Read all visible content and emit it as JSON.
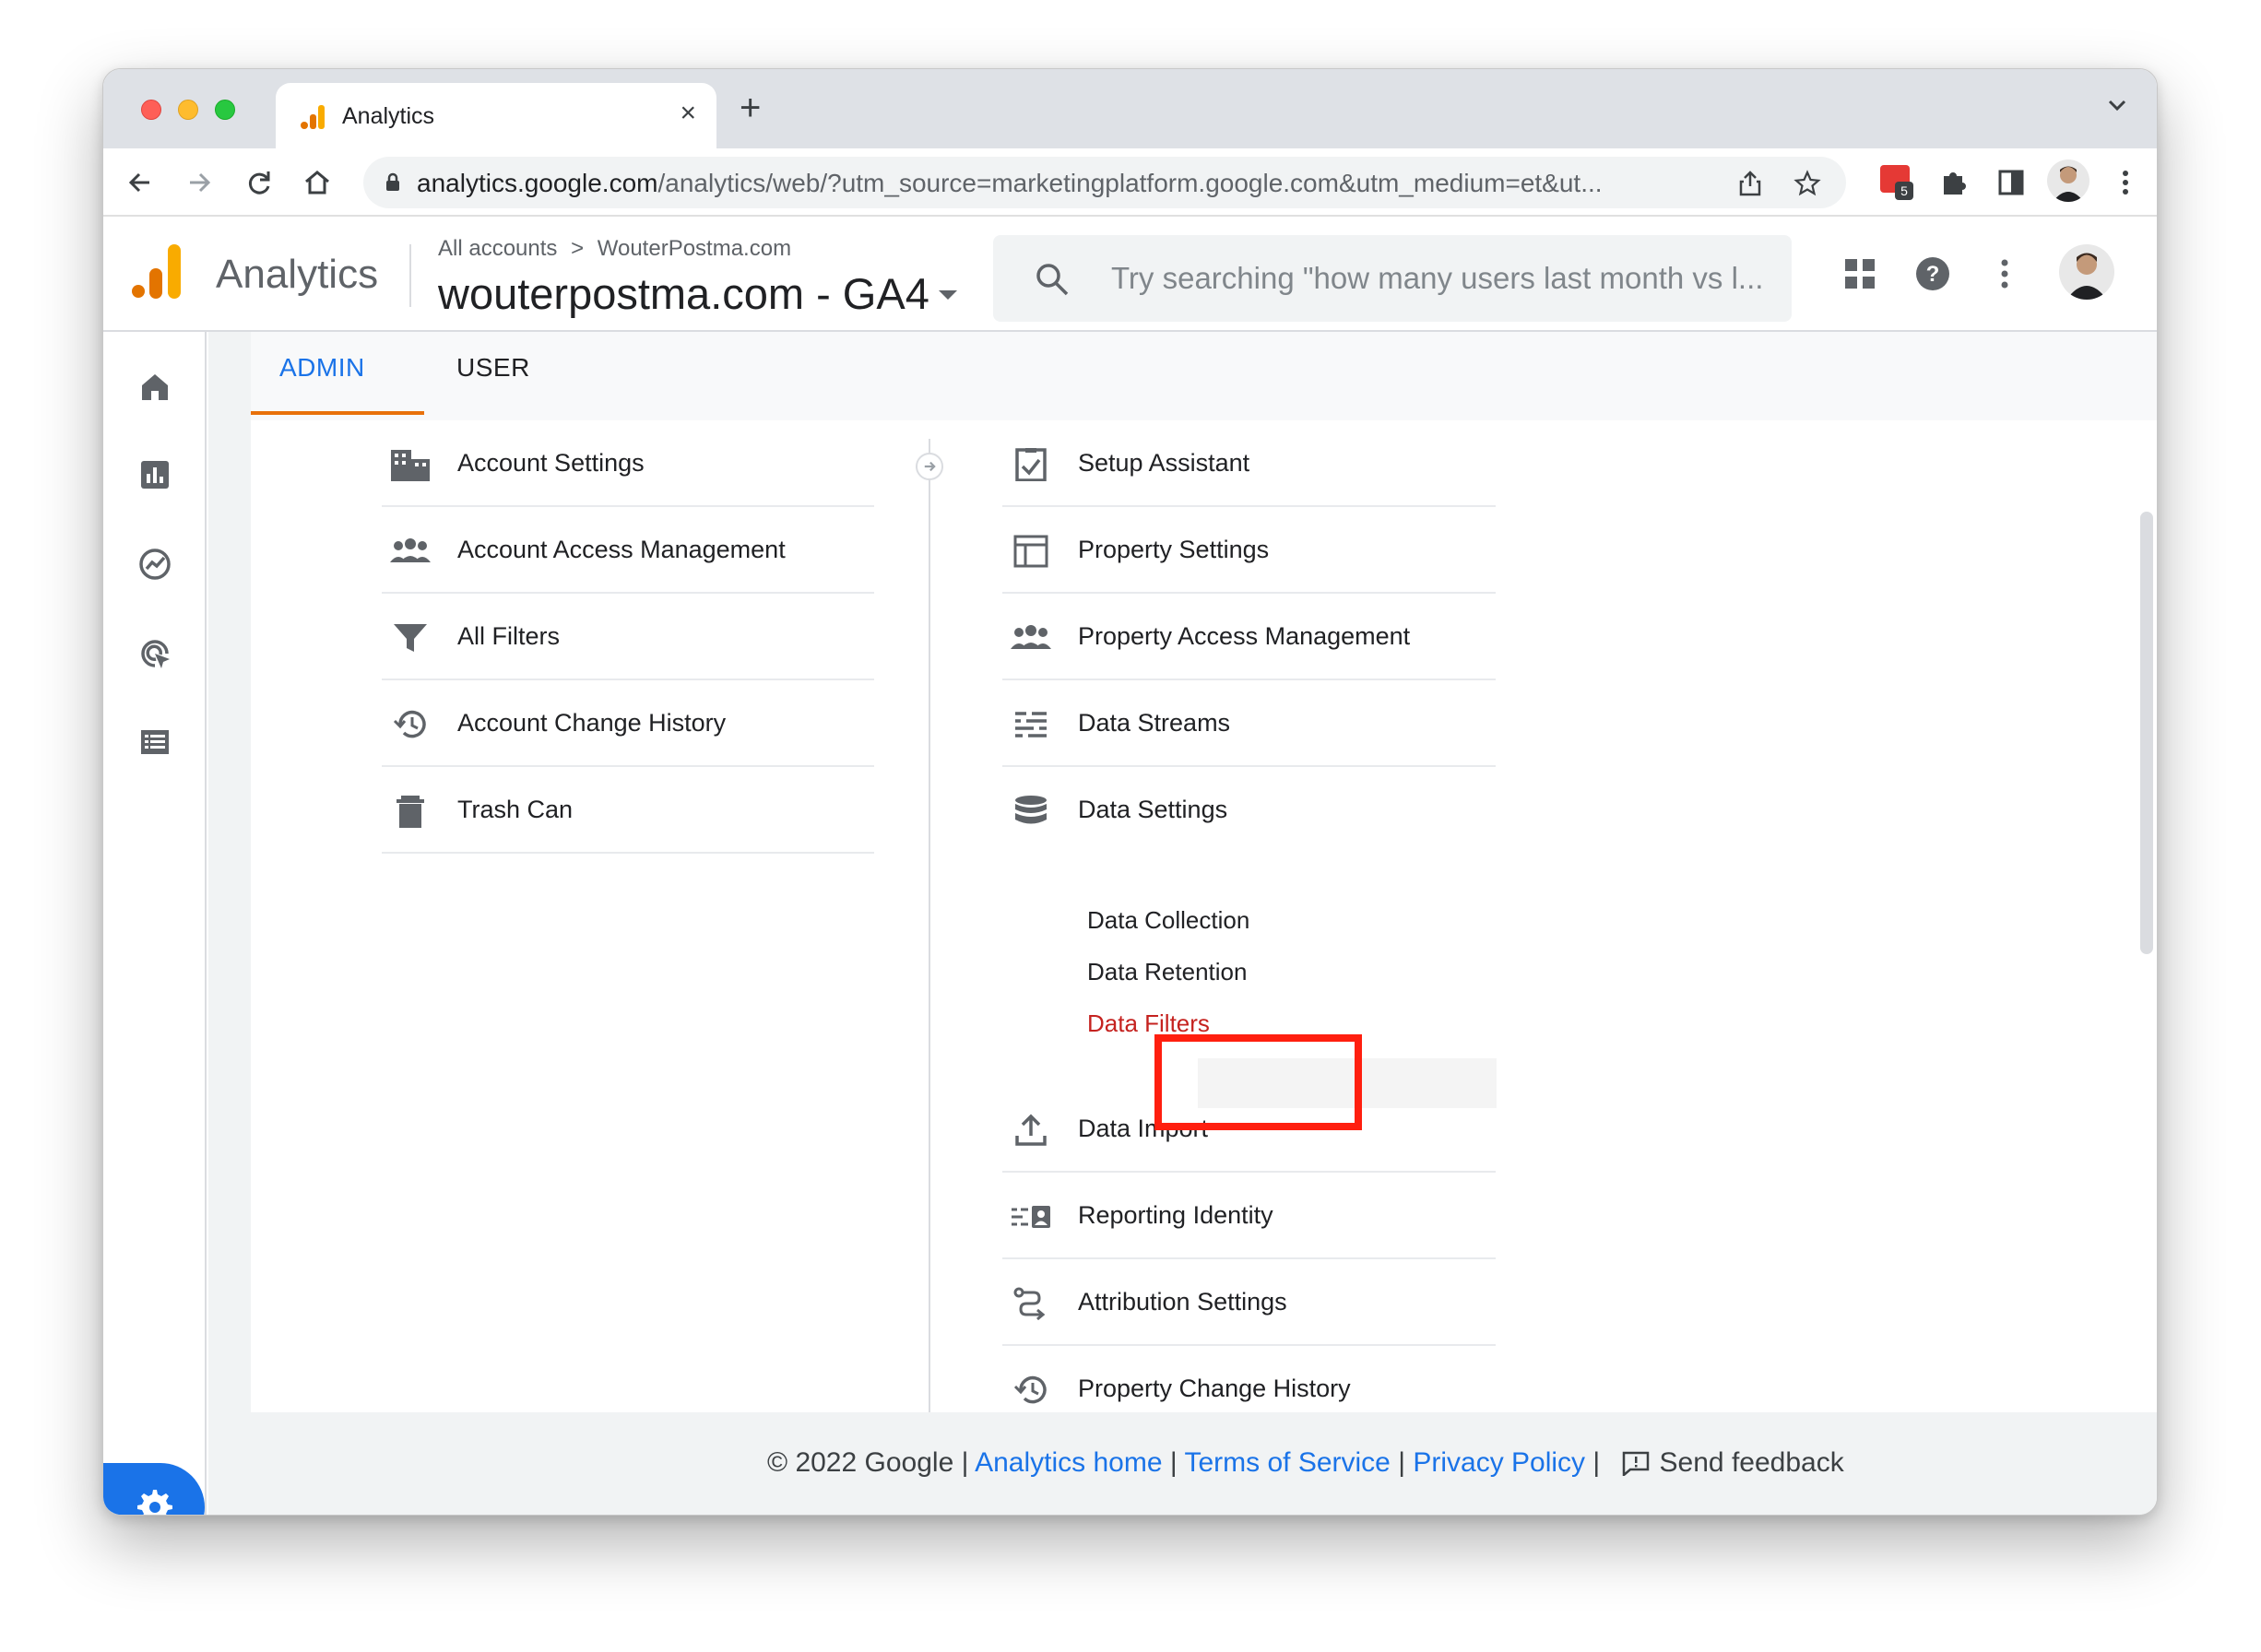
{
  "browser": {
    "tab_title": "Analytics",
    "url_host": "analytics.google.com",
    "url_path": "/analytics/web/?utm_source=marketingplatform.google.com&utm_medium=et&ut...",
    "extension_badge": "5"
  },
  "header": {
    "app_name": "Analytics",
    "breadcrumb_root": "All accounts",
    "breadcrumb_sep": ">",
    "breadcrumb_account": "WouterPostma.com",
    "property_name": "wouterpostma.com - GA4",
    "search_placeholder": "Try searching \"how many users last month vs l..."
  },
  "admin_tabs": [
    {
      "label": "ADMIN",
      "active": true
    },
    {
      "label": "USER",
      "active": false
    }
  ],
  "account_column": {
    "items": [
      {
        "label": "Account Settings",
        "icon": "building-icon"
      },
      {
        "label": "Account Access Management",
        "icon": "people-icon"
      },
      {
        "label": "All Filters",
        "icon": "filter-icon"
      },
      {
        "label": "Account Change History",
        "icon": "history-icon"
      },
      {
        "label": "Trash Can",
        "icon": "trash-icon"
      }
    ]
  },
  "property_column": {
    "items": [
      {
        "label": "Setup Assistant",
        "icon": "checklist-icon"
      },
      {
        "label": "Property Settings",
        "icon": "layout-icon"
      },
      {
        "label": "Property Access Management",
        "icon": "people-icon"
      },
      {
        "label": "Data Streams",
        "icon": "streams-icon"
      },
      {
        "label": "Data Settings",
        "icon": "database-icon"
      }
    ],
    "data_settings_sub": [
      "Data Collection",
      "Data Retention",
      "Data Filters"
    ],
    "items_after": [
      {
        "label": "Data Import",
        "icon": "upload-icon"
      },
      {
        "label": "Reporting Identity",
        "icon": "identity-icon"
      },
      {
        "label": "Attribution Settings",
        "icon": "attribution-icon"
      },
      {
        "label": "Property Change History",
        "icon": "history-icon"
      }
    ]
  },
  "footer": {
    "copyright": "© 2022 Google",
    "sep": "|",
    "analytics_home": "Analytics home",
    "terms": "Terms of Service",
    "privacy": "Privacy Policy",
    "feedback": "Send feedback"
  },
  "colors": {
    "accent": "#1a73e8",
    "tab_underline": "#e8710a",
    "highlight_box": "#ff1f0f",
    "active_sub": "#c5221f"
  }
}
